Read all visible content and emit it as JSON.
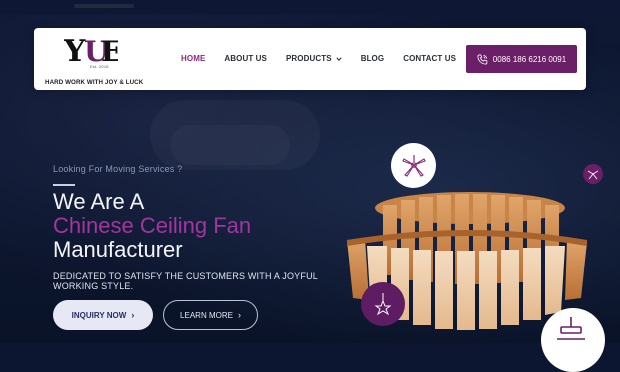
{
  "brand": {
    "logo_text": "YUE",
    "est": "Est. 2015",
    "tagline": "HARD WORK WITH JOY & LUCK"
  },
  "nav": {
    "items": [
      {
        "label": "HOME",
        "active": true
      },
      {
        "label": "ABOUT US"
      },
      {
        "label": "PRODUCTS",
        "has_dropdown": true
      },
      {
        "label": "BLOG"
      },
      {
        "label": "CONTACT US"
      }
    ],
    "phone": "0086 186 6216 0091"
  },
  "hero": {
    "eyebrow": "Looking For Moving Services ?",
    "headline_1": "We Are A",
    "headline_2": "Chinese Ceiling Fan",
    "headline_3": "Manufacturer",
    "subline": "DEDICATED TO SATISFY THE CUSTOMERS WITH A JOYFUL WORKING STYLE.",
    "primary_button": "INQUIRY NOW",
    "secondary_button": "LEARN MORE"
  },
  "colors": {
    "brand_purple": "#6a1f66",
    "highlight_magenta": "#a235a0",
    "background_navy": "#0c1630"
  },
  "icons": [
    "phone-icon",
    "chevron-down-icon",
    "arrow-right-icon",
    "ceiling-fan-icon",
    "star-icon",
    "lamp-icon"
  ]
}
